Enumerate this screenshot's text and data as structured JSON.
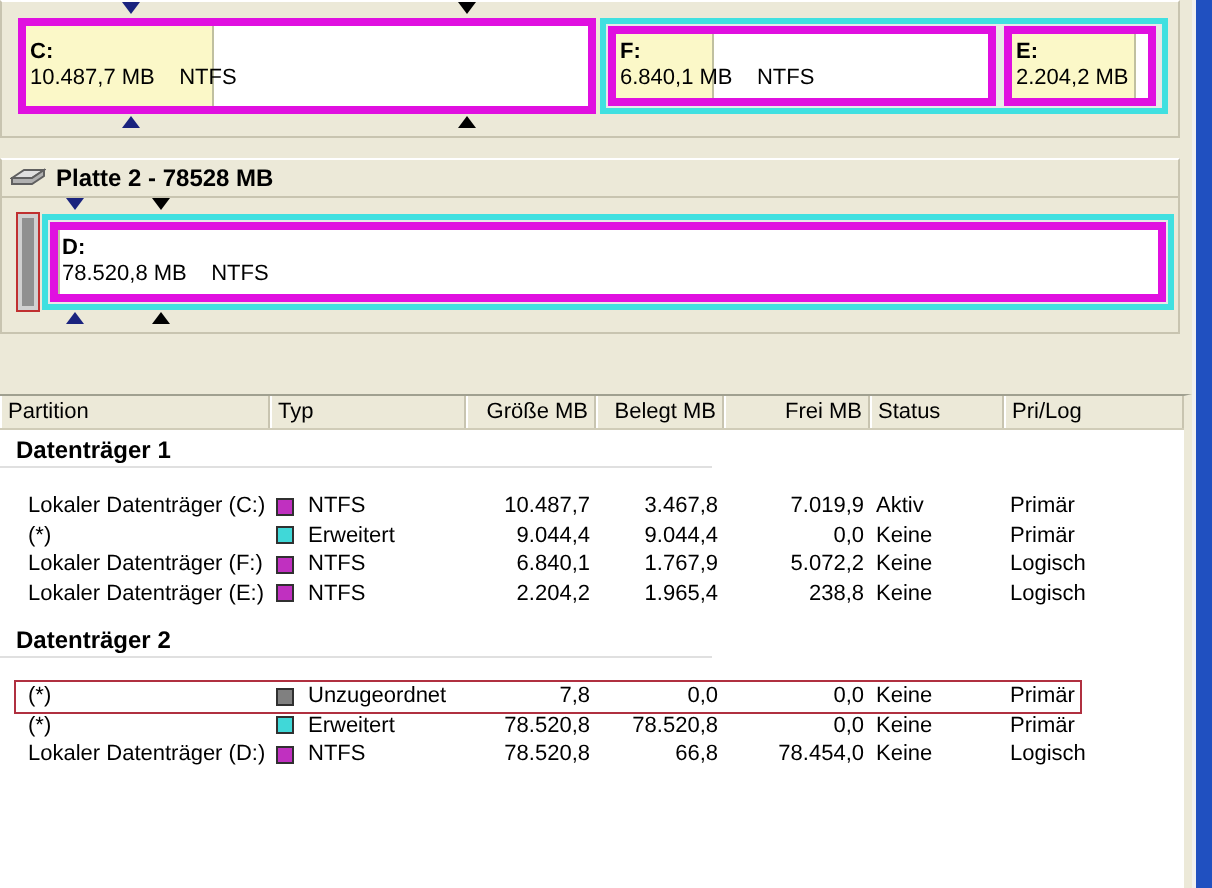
{
  "disks": [
    {
      "map": [
        {
          "kind": "partition",
          "label": "C:",
          "size": "10.487,7 MB",
          "fs": "NTFS",
          "level": 0.33
        },
        {
          "kind": "extended",
          "children": [
            {
              "kind": "partition",
              "label": "F:",
              "size": "6.840,1 MB",
              "fs": "NTFS",
              "level": 0.26
            },
            {
              "kind": "partition",
              "label": "E:",
              "size": "2.204,2 MB",
              "level": 0.89
            }
          ]
        }
      ]
    },
    {
      "title": "Platte 2 - 78528 MB",
      "map": [
        {
          "kind": "unallocated",
          "highlighted": true
        },
        {
          "kind": "extended",
          "children": [
            {
              "kind": "partition",
              "label": "D:",
              "size": "78.520,8 MB",
              "fs": "NTFS",
              "level": 0.0
            }
          ]
        }
      ]
    }
  ],
  "table": {
    "columns": [
      "Partition",
      "Typ",
      "Größe MB",
      "Belegt MB",
      "Frei MB",
      "Status",
      "Pri/Log"
    ],
    "groups": [
      {
        "title": "Datenträger 1",
        "rows": [
          {
            "cells": [
              "Lokaler Datenträger (C:)",
              "NTFS",
              "10.487,7",
              "3.467,8",
              "7.019,9",
              "Aktiv",
              "Primär"
            ],
            "color": "#c030c0",
            "highlighted": false
          },
          {
            "cells": [
              "(*)",
              "Erweitert",
              "9.044,4",
              "9.044,4",
              "0,0",
              "Keine",
              "Primär"
            ],
            "color": "#40d8d8",
            "highlighted": false
          },
          {
            "cells": [
              "Lokaler Datenträger (F:)",
              "NTFS",
              "6.840,1",
              "1.767,9",
              "5.072,2",
              "Keine",
              "Logisch"
            ],
            "color": "#c030c0",
            "highlighted": false
          },
          {
            "cells": [
              "Lokaler Datenträger (E:)",
              "NTFS",
              "2.204,2",
              "1.965,4",
              "238,8",
              "Keine",
              "Logisch"
            ],
            "color": "#c030c0",
            "highlighted": false
          }
        ]
      },
      {
        "title": "Datenträger 2",
        "rows": [
          {
            "cells": [
              "(*)",
              "Unzugeordnet",
              "7,8",
              "0,0",
              "0,0",
              "Keine",
              "Primär"
            ],
            "color": "#808080",
            "highlighted": true
          },
          {
            "cells": [
              "(*)",
              "Erweitert",
              "78.520,8",
              "78.520,8",
              "0,0",
              "Keine",
              "Primär"
            ],
            "color": "#40d8d8",
            "highlighted": false
          },
          {
            "cells": [
              "Lokaler Datenträger (D:)",
              "NTFS",
              "78.520,8",
              "66,8",
              "78.454,0",
              "Keine",
              "Logisch"
            ],
            "color": "#c030c0",
            "highlighted": false
          }
        ]
      }
    ]
  }
}
